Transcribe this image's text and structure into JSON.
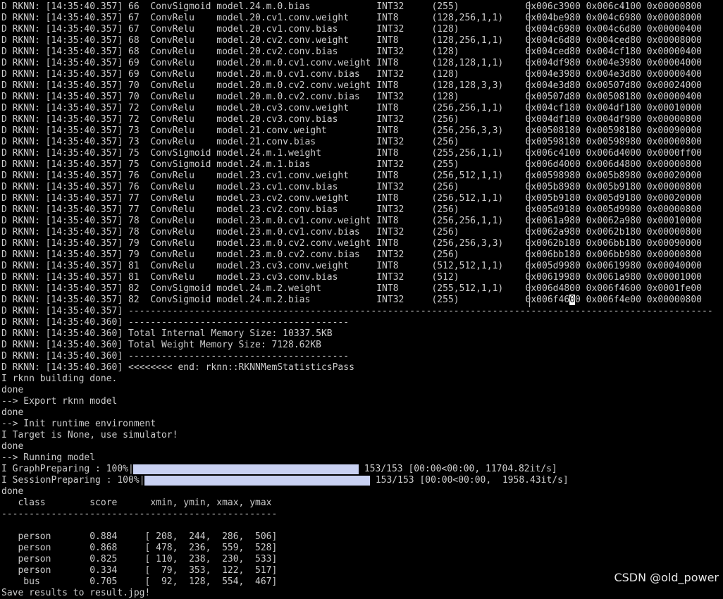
{
  "colors": {
    "background": "#000000",
    "text": "#cccccc",
    "progress_fill": "#c9d1f2",
    "separator": "#bdbdbd"
  },
  "terminal": {
    "memory_table_rows": [
      "D RKNN: [14:35:40.357] 66  ConvSigmoid model.24.m.0.bias            INT32     (255)            0x006c3900 0x006c4100 0x00000800",
      "D RKNN: [14:35:40.357] 67  ConvRelu    model.20.cv1.conv.weight     INT8      (128,256,1,1)    0x004be980 0x004c6980 0x00008000",
      "D RKNN: [14:35:40.357] 67  ConvRelu    model.20.cv1.conv.bias       INT32     (128)            0x004c6980 0x004c6d80 0x00000400",
      "D RKNN: [14:35:40.357] 68  ConvRelu    model.20.cv2.conv.weight     INT8      (128,256,1,1)    0x004c6d80 0x004ced80 0x00008000",
      "D RKNN: [14:35:40.357] 68  ConvRelu    model.20.cv2.conv.bias       INT32     (128)            0x004ced80 0x004cf180 0x00000400",
      "D RKNN: [14:35:40.357] 69  ConvRelu    model.20.m.0.cv1.conv.weight INT8      (128,128,1,1)    0x004df980 0x004e3980 0x00004000",
      "D RKNN: [14:35:40.357] 69  ConvRelu    model.20.m.0.cv1.conv.bias   INT32     (128)            0x004e3980 0x004e3d80 0x00000400",
      "D RKNN: [14:35:40.357] 70  ConvRelu    model.20.m.0.cv2.conv.weight INT8      (128,128,3,3)    0x004e3d80 0x00507d80 0x00024000",
      "D RKNN: [14:35:40.357] 70  ConvRelu    model.20.m.0.cv2.conv.bias   INT32     (128)            0x00507d80 0x00508180 0x00000400",
      "D RKNN: [14:35:40.357] 72  ConvRelu    model.20.cv3.conv.weight     INT8      (256,256,1,1)    0x004cf180 0x004df180 0x00010000",
      "D RKNN: [14:35:40.357] 72  ConvRelu    model.20.cv3.conv.bias       INT32     (256)            0x004df180 0x004df980 0x00000800",
      "D RKNN: [14:35:40.357] 73  ConvRelu    model.21.conv.weight         INT8      (256,256,3,3)    0x00508180 0x00598180 0x00090000",
      "D RKNN: [14:35:40.357] 73  ConvRelu    model.21.conv.bias           INT32     (256)            0x00598180 0x00598980 0x00000800",
      "D RKNN: [14:35:40.357] 75  ConvSigmoid model.24.m.1.weight          INT8      (255,256,1,1)    0x006c4100 0x006d4000 0x0000ff00",
      "D RKNN: [14:35:40.357] 75  ConvSigmoid model.24.m.1.bias            INT32     (255)            0x006d4000 0x006d4800 0x00000800",
      "D RKNN: [14:35:40.357] 76  ConvRelu    model.23.cv1.conv.weight     INT8      (256,512,1,1)    0x00598980 0x005b8980 0x00020000",
      "D RKNN: [14:35:40.357] 76  ConvRelu    model.23.cv1.conv.bias       INT32     (256)            0x005b8980 0x005b9180 0x00000800",
      "D RKNN: [14:35:40.357] 77  ConvRelu    model.23.cv2.conv.weight     INT8      (256,512,1,1)    0x005b9180 0x005d9180 0x00020000",
      "D RKNN: [14:35:40.357] 77  ConvRelu    model.23.cv2.conv.bias       INT32     (256)            0x005d9180 0x005d9980 0x00000800",
      "D RKNN: [14:35:40.357] 78  ConvRelu    model.23.m.0.cv1.conv.weight INT8      (256,256,1,1)    0x0061a980 0x0062a980 0x00010000",
      "D RKNN: [14:35:40.357] 78  ConvRelu    model.23.m.0.cv1.conv.bias   INT32     (256)            0x0062a980 0x0062b180 0x00000800",
      "D RKNN: [14:35:40.357] 79  ConvRelu    model.23.m.0.cv2.conv.weight INT8      (256,256,3,3)    0x0062b180 0x006bb180 0x00090000",
      "D RKNN: [14:35:40.357] 79  ConvRelu    model.23.m.0.cv2.conv.bias   INT32     (256)            0x006bb180 0x006bb980 0x00000800",
      "D RKNN: [14:35:40.357] 81  ConvRelu    model.23.cv3.conv.weight     INT8      (512,512,1,1)    0x005d9980 0x00619980 0x00040000",
      "D RKNN: [14:35:40.357] 81  ConvRelu    model.23.cv3.conv.bias       INT32     (512)            0x00619980 0x0061a980 0x00001000",
      "D RKNN: [14:35:40.357] 82  ConvSigmoid model.24.m.2.weight          INT8      (255,512,1,1)    0x006d4800 0x006f4600 0x0001fe00"
    ],
    "last_row_prefix": "D RKNN: [14:35:40.357] 82  ConvSigmoid model.24.m.2.bias            INT32     (255)            0x006f46",
    "last_row_cursor_char": "0",
    "last_row_suffix": "0 0x006f4e00 0x00000800",
    "log_after_table": [
      "D RKNN: [14:35:40.357] ----------------------------------------------------------------------------------------------------------",
      "D RKNN: [14:35:40.360] ----------------------------------------",
      "D RKNN: [14:35:40.360] Total Internal Memory Size: 10337.5KB",
      "D RKNN: [14:35:40.360] Total Weight Memory Size: 7128.62KB",
      "D RKNN: [14:35:40.360] ----------------------------------------",
      "D RKNN: [14:35:40.360] <<<<<<<< end: rknn::RKNNMemStatisticsPass",
      "I rknn building done.",
      "done",
      "--> Export rknn model",
      "done",
      "--> Init runtime environment",
      "I Target is None, use simulator!",
      "done",
      "--> Running model"
    ],
    "progress_bars": [
      {
        "label": "I GraphPreparing : 100%|",
        "stats": " 153/153 [00:00<00:00, 11704.82it/s]",
        "percent": 100
      },
      {
        "label": "I SessionPreparing : 100%|",
        "stats": " 153/153 [00:00<00:00,  1958.43it/s]",
        "percent": 100
      }
    ],
    "after_progress": "done",
    "results_header": "   class        score      xmin, ymin, xmax, ymax",
    "results_divider": "--------------------------------------------------",
    "results_rows": [
      "   person       0.884     [ 208,  244,  286,  506]",
      "   person       0.868     [ 478,  236,  559,  528]",
      "   person       0.825     [ 110,  238,  230,  533]",
      "   person       0.334     [  79,  353,  122,  517]",
      "    bus         0.705     [  92,  128,  554,  467]"
    ],
    "save_message": "Save results to result.jpg!"
  },
  "watermark": "CSDN @old_power"
}
